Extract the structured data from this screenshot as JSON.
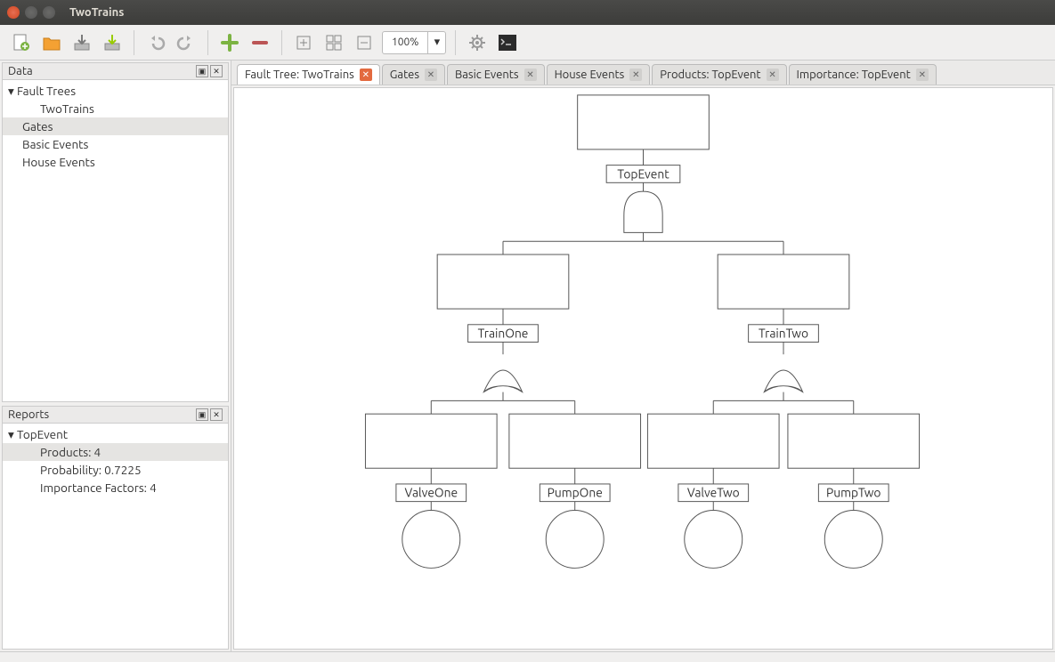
{
  "window": {
    "title": "TwoTrains"
  },
  "toolbar": {
    "zoom": "100%"
  },
  "sidebar": {
    "data": {
      "title": "Data",
      "tree": {
        "root": "Fault Trees",
        "items": [
          "TwoTrains",
          "Gates",
          "Basic Events",
          "House Events"
        ],
        "selected": "Gates"
      }
    },
    "reports": {
      "title": "Reports",
      "root": "TopEvent",
      "items": [
        "Products: 4",
        "Probability: 0.7225",
        "Importance Factors: 4"
      ],
      "selected": "Products: 4"
    }
  },
  "tabs": [
    {
      "label": "Fault Tree: TwoTrains",
      "active": true
    },
    {
      "label": "Gates",
      "active": false
    },
    {
      "label": "Basic Events",
      "active": false
    },
    {
      "label": "House Events",
      "active": false
    },
    {
      "label": "Products: TopEvent",
      "active": false
    },
    {
      "label": "Importance: TopEvent",
      "active": false
    }
  ],
  "diagram": {
    "top_event": "TopEvent",
    "gates": [
      {
        "name": "TrainOne",
        "type": "OR",
        "children": [
          "ValveOne",
          "PumpOne"
        ]
      },
      {
        "name": "TrainTwo",
        "type": "OR",
        "children": [
          "ValveTwo",
          "PumpTwo"
        ]
      }
    ],
    "basic_events": [
      "ValveOne",
      "PumpOne",
      "ValveTwo",
      "PumpTwo"
    ],
    "top_gate_type": "AND"
  }
}
